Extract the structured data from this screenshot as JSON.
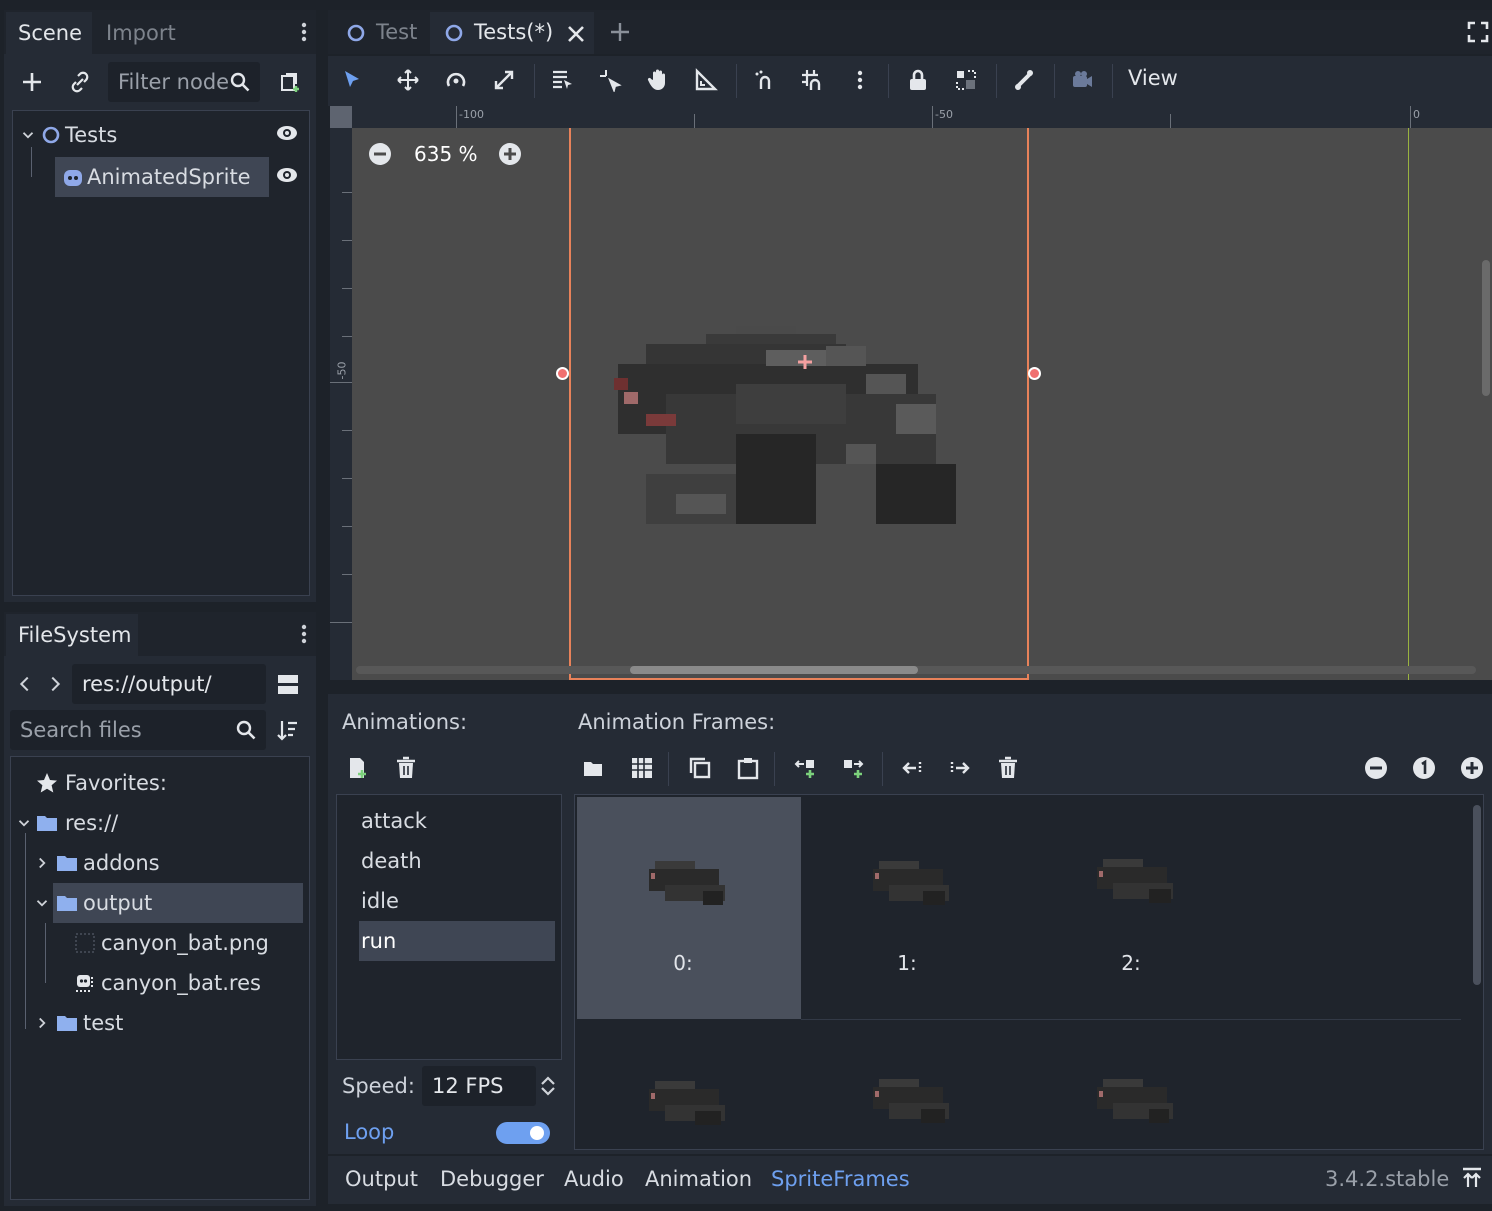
{
  "scene_dock": {
    "tabs": [
      "Scene",
      "Import"
    ],
    "filter_placeholder": "Filter node",
    "tree": [
      {
        "label": "Tests"
      },
      {
        "label": "AnimatedSprite"
      }
    ]
  },
  "filesystem_dock": {
    "tab": "FileSystem",
    "path": "res://output/",
    "search_placeholder": "Search files",
    "items": [
      {
        "label": "Favorites:"
      },
      {
        "label": "res://"
      },
      {
        "label": "addons"
      },
      {
        "label": "output"
      },
      {
        "label": "canyon_bat.png"
      },
      {
        "label": "canyon_bat.res"
      },
      {
        "label": "test"
      }
    ]
  },
  "editor_tabs": [
    {
      "label": "Test"
    },
    {
      "label": "Tests(*)"
    }
  ],
  "toolbar": {
    "view_label": "View"
  },
  "viewport": {
    "zoom": "635 %",
    "ruler_h": [
      "-100",
      "-50",
      "0"
    ],
    "ruler_v": [
      "-50"
    ]
  },
  "spriteframes": {
    "animations_title": "Animations:",
    "frames_title": "Animation Frames:",
    "animations": [
      "attack",
      "death",
      "idle",
      "run"
    ],
    "selected_animation": "run",
    "frames": [
      "0:",
      "1:",
      "2:"
    ],
    "speed_label": "Speed:",
    "speed_value": "12 FPS",
    "loop_label": "Loop"
  },
  "bottom_panel": {
    "tabs": [
      "Output",
      "Debugger",
      "Audio",
      "Animation",
      "SpriteFrames"
    ],
    "active": "SpriteFrames",
    "version": "3.4.2.stable"
  },
  "colors": {
    "accent": "#6ea0f0",
    "selection_rect": "#e8825a",
    "viewport_bg": "#4b4b4b"
  }
}
